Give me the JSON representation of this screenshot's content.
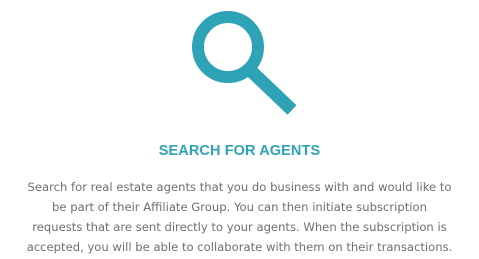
{
  "feature": {
    "icon": "search-icon",
    "title": "SEARCH FOR AGENTS",
    "description_lines": [
      "Search for real estate agents that you do business with and would like to",
      "be part of their Affiliate Group. You can then initiate subscription",
      "requests that are sent directly to your agents. When the subscription is",
      "accepted, you will be able to collaborate with them on their transactions."
    ]
  },
  "colors": {
    "accent": "#2ea3b5",
    "body_text": "#6f6f6f",
    "background": "#ffffff"
  }
}
